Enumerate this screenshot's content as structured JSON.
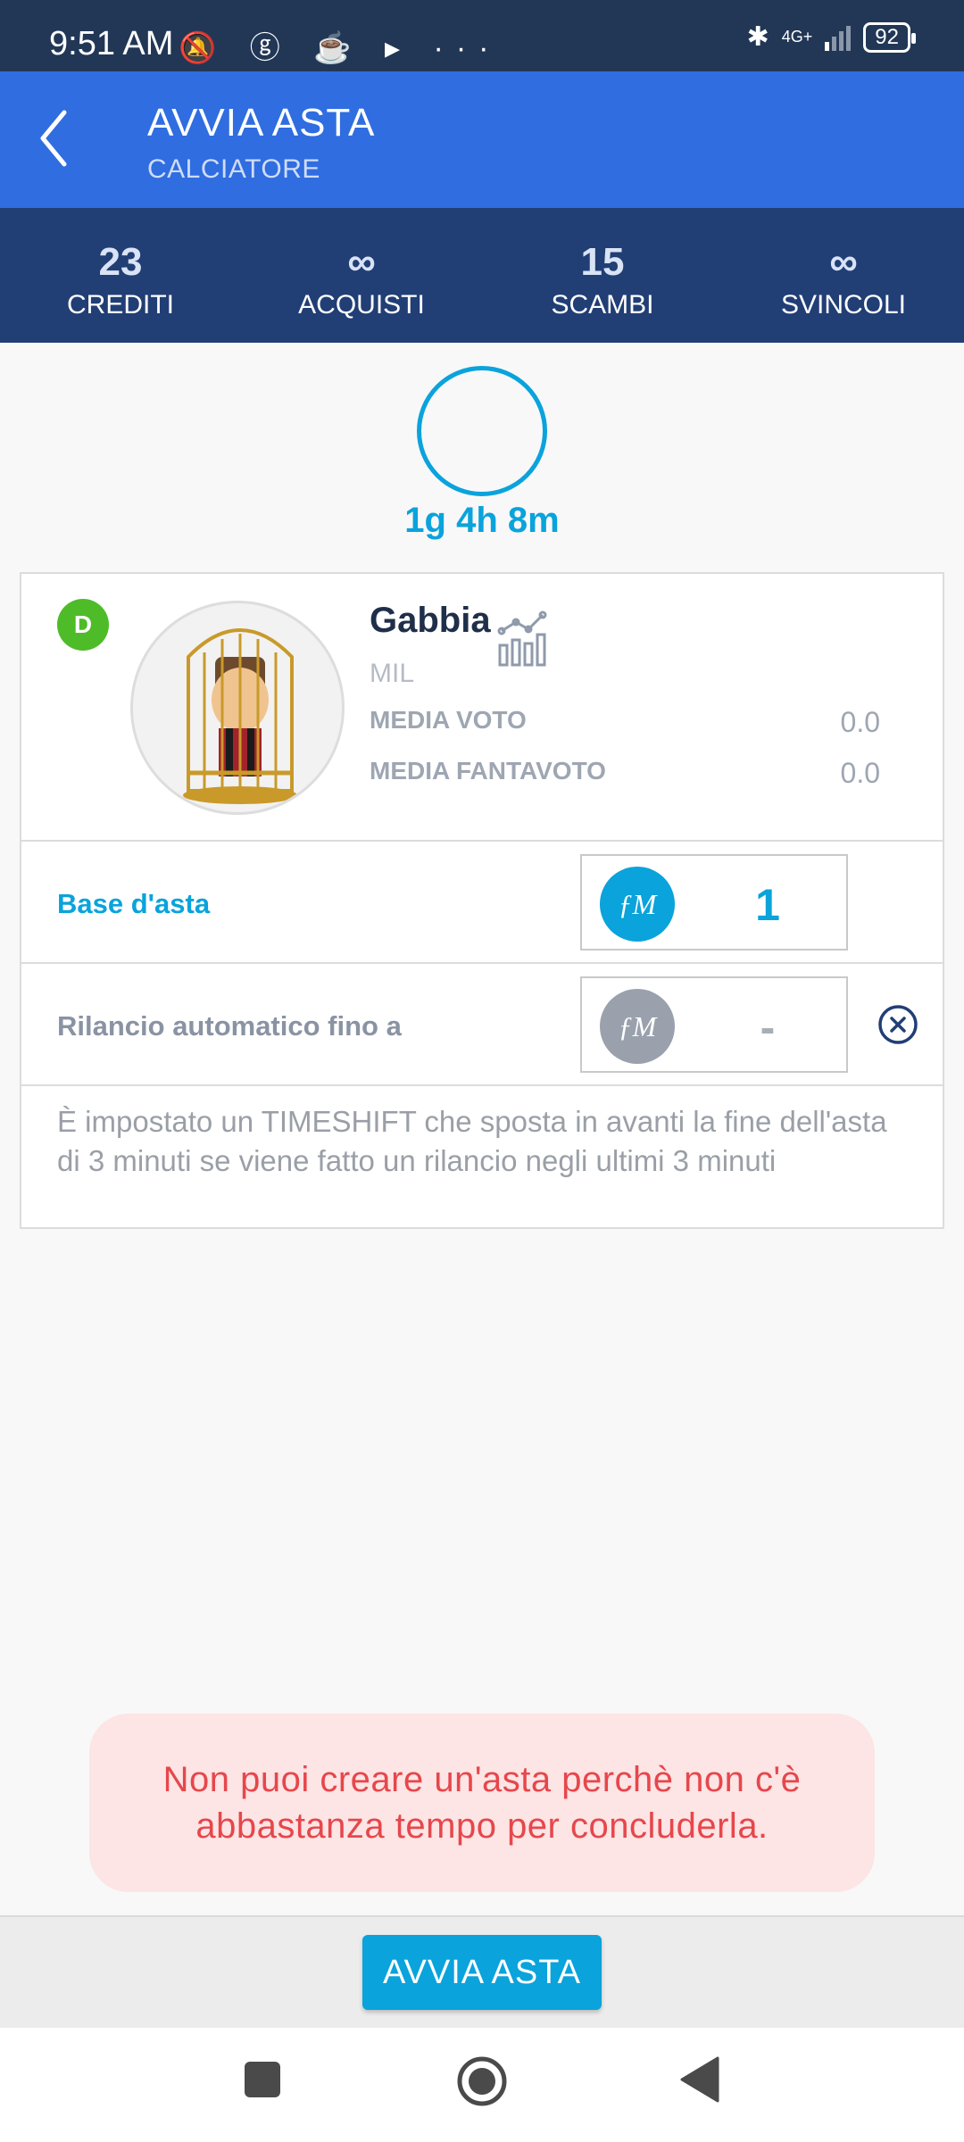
{
  "status_bar": {
    "time": "9:51 AM",
    "network": "4G+",
    "battery": "92"
  },
  "app_bar": {
    "title": "AVVIA ASTA",
    "subtitle": "CALCIATORE"
  },
  "stats": [
    {
      "value": "23",
      "label": "CREDITI"
    },
    {
      "value": "∞",
      "label": "ACQUISTI"
    },
    {
      "value": "15",
      "label": "SCAMBI"
    },
    {
      "value": "∞",
      "label": "SVINCOLI"
    }
  ],
  "timer": {
    "text": "1g 4h 8m"
  },
  "player": {
    "role": "D",
    "name": "Gabbia",
    "team": "MIL",
    "media_voto_label": "MEDIA VOTO",
    "media_voto_value": "0.0",
    "media_fantavoto_label": "MEDIA FANTAVOTO",
    "media_fantavoto_value": "0.0"
  },
  "base_asta": {
    "label": "Base d'asta",
    "currency_icon": "ƒM",
    "value": "1",
    "accent": "#0aa3dc"
  },
  "rilancio": {
    "label": "Rilancio automatico fino a",
    "currency_icon": "ƒM",
    "value": "-",
    "color": "#8a93a3"
  },
  "info": {
    "text": "È impostato un TIMESHIFT che sposta in avanti la fine dell'asta di 3 minuti se viene fatto un rilancio negli ultimi 3 minuti"
  },
  "toast": {
    "line1": "Non puoi creare un'asta perchè non c'è",
    "line2": "abbastanza tempo per concluderla."
  },
  "action": {
    "button_label": "AVVIA ASTA"
  }
}
